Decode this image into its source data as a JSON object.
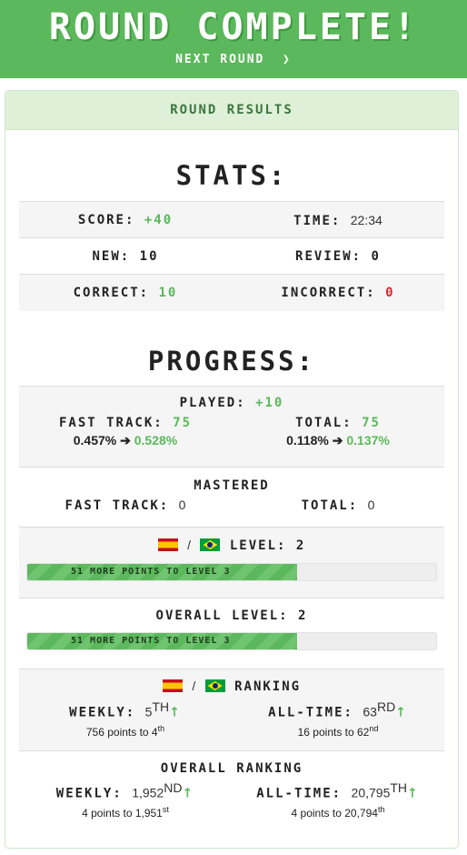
{
  "banner": {
    "title": "ROUND COMPLETE!",
    "next_round": "NEXT ROUND",
    "next_icon": "chevron-right-icon"
  },
  "card": {
    "header": "ROUND RESULTS"
  },
  "stats": {
    "title": "STATS:",
    "score_label": "SCORE:",
    "score_value": "+40",
    "time_label": "TIME:",
    "time_value": "22:34",
    "new_label": "NEW:",
    "new_value": "10",
    "review_label": "REVIEW:",
    "review_value": "0",
    "correct_label": "CORRECT:",
    "correct_value": "10",
    "incorrect_label": "INCORRECT:",
    "incorrect_value": "0"
  },
  "progress": {
    "title": "PROGRESS:",
    "played_label": "PLAYED:",
    "played_value": "+10",
    "fast_track_label": "FAST TRACK:",
    "fast_track_value": "75",
    "fast_track_from": "0.457%",
    "fast_track_to": "0.528%",
    "total_label": "TOTAL:",
    "total_value": "75",
    "total_from": "0.118%",
    "total_to": "0.137%",
    "mastered_title": "MASTERED",
    "mastered_fast_label": "FAST TRACK:",
    "mastered_fast_value": "0",
    "mastered_total_label": "TOTAL:",
    "mastered_total_value": "0",
    "level_label": "LEVEL:",
    "level_value": "2",
    "level_bar_text": "51 MORE POINTS TO LEVEL 3",
    "level_progress": 0.66,
    "overall_level_label": "OVERALL LEVEL:",
    "overall_level_value": "2",
    "overall_bar_text": "51 MORE POINTS TO LEVEL 3",
    "overall_progress": 0.66
  },
  "ranking": {
    "title": "RANKING",
    "weekly_label": "WEEKLY:",
    "weekly_value": "5",
    "weekly_sup": "th",
    "weekly_note": "756 points to 4",
    "weekly_note_sup": "th",
    "alltime_label": "ALL-TIME:",
    "alltime_value": "63",
    "alltime_sup": "rd",
    "alltime_note": "16 points to 62",
    "alltime_note_sup": "nd"
  },
  "overall_ranking": {
    "title": "OVERALL RANKING",
    "weekly_label": "WEEKLY:",
    "weekly_value": "1,952",
    "weekly_sup": "nd",
    "weekly_note": "4 points to 1,951",
    "weekly_note_sup": "st",
    "alltime_label": "ALL-TIME:",
    "alltime_value": "20,795",
    "alltime_sup": "th",
    "alltime_note": "4 points to 20,794",
    "alltime_note_sup": "th"
  },
  "colors": {
    "accent": "#5cb85c",
    "header_bg": "#dff0d8",
    "negative": "#d9252b"
  },
  "flags": [
    "spain-flag-icon",
    "brazil-flag-icon"
  ]
}
